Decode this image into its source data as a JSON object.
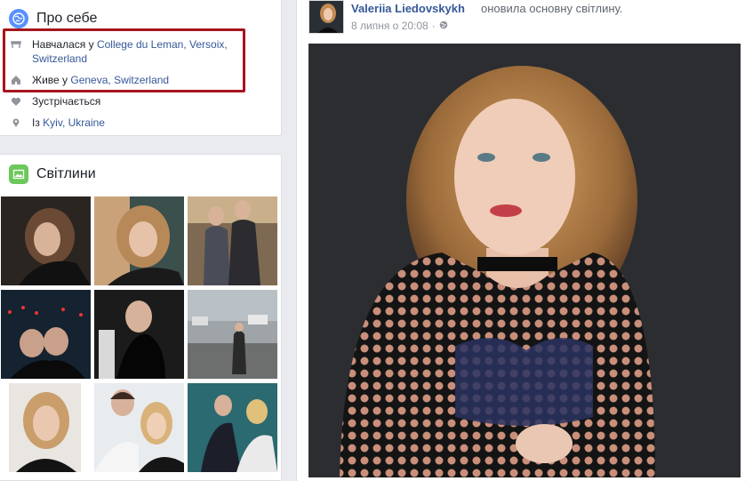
{
  "about": {
    "title": "Про себе",
    "rows": [
      {
        "prefix": "Навчалася у ",
        "link": "College du Leman, Versoix, Switzerland",
        "icon": "education-icon"
      },
      {
        "prefix": "Живе у ",
        "link": "Geneva, Switzerland",
        "icon": "home-icon"
      },
      {
        "prefix": "Зустрічається",
        "link": "",
        "icon": "heart-icon"
      },
      {
        "prefix": "Із ",
        "link": "Kyiv, Ukraine",
        "icon": "location-pin-icon"
      }
    ]
  },
  "photos": {
    "title": "Світлини"
  },
  "post": {
    "author": "Valeriia Liedovskykh",
    "action": "оновила основну світлину.",
    "date": "8 липня о 20:08",
    "privacy_icon": "globe-icon"
  },
  "colors": {
    "link": "#365899",
    "highlight": "#a5151d",
    "globe_bg": "#5890ff",
    "photos_bg": "#6bc85b"
  }
}
